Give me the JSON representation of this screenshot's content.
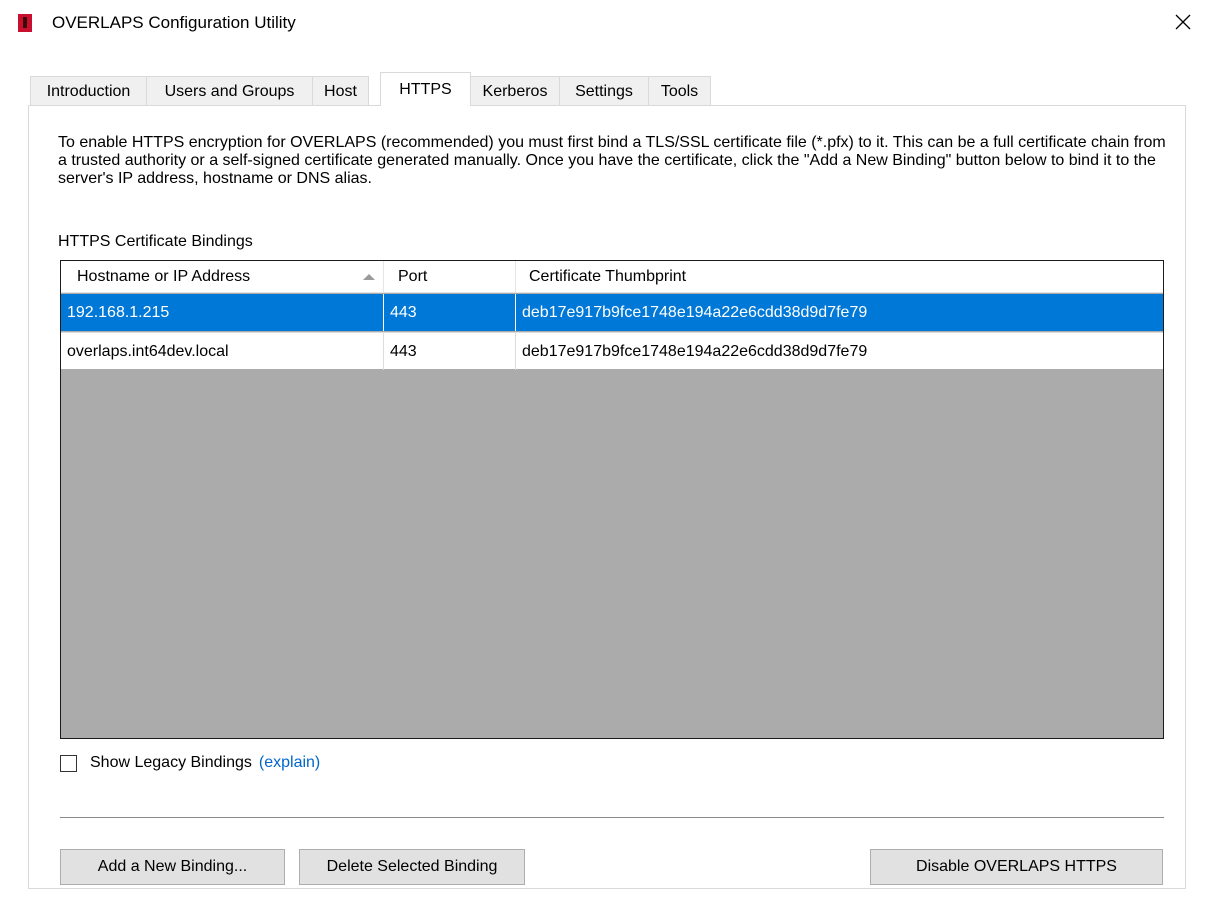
{
  "window": {
    "title": "OVERLAPS Configuration Utility"
  },
  "tabs": [
    {
      "label": "Introduction"
    },
    {
      "label": "Users and Groups"
    },
    {
      "label": "Host"
    },
    {
      "label": "HTTPS",
      "active": true
    },
    {
      "label": "Kerberos"
    },
    {
      "label": "Settings"
    },
    {
      "label": "Tools"
    }
  ],
  "https": {
    "intro_text": "To enable HTTPS encryption for OVERLAPS (recommended) you must first bind a TLS/SSL certificate file (*.pfx) to it. This can be a full certificate chain from a trusted authority or a self-signed certificate generated manually. Once you have the certificate, click the \"Add a New Binding\" button below to bind it to the server's IP address, hostname or DNS alias.",
    "bindings_label": "HTTPS Certificate Bindings",
    "columns": [
      "Hostname or IP Address",
      "Port",
      "Certificate Thumbprint"
    ],
    "rows": [
      {
        "hostname": "192.168.1.215",
        "port": "443",
        "thumbprint": "deb17e917b9fce1748e194a22e6cdd38d9d7fe79",
        "selected": true
      },
      {
        "hostname": "overlaps.int64dev.local",
        "port": "443",
        "thumbprint": "deb17e917b9fce1748e194a22e6cdd38d9d7fe79",
        "selected": false
      }
    ],
    "show_legacy_label": "Show Legacy Bindings",
    "show_legacy_checked": false,
    "explain_link": "(explain)",
    "buttons": {
      "add": "Add a New Binding...",
      "delete": "Delete Selected Binding",
      "disable": "Disable OVERLAPS HTTPS"
    }
  },
  "colors": {
    "selection": "#0078d7",
    "list_background": "#ababab",
    "link": "#0066cc",
    "app_icon": "#c8102e"
  }
}
